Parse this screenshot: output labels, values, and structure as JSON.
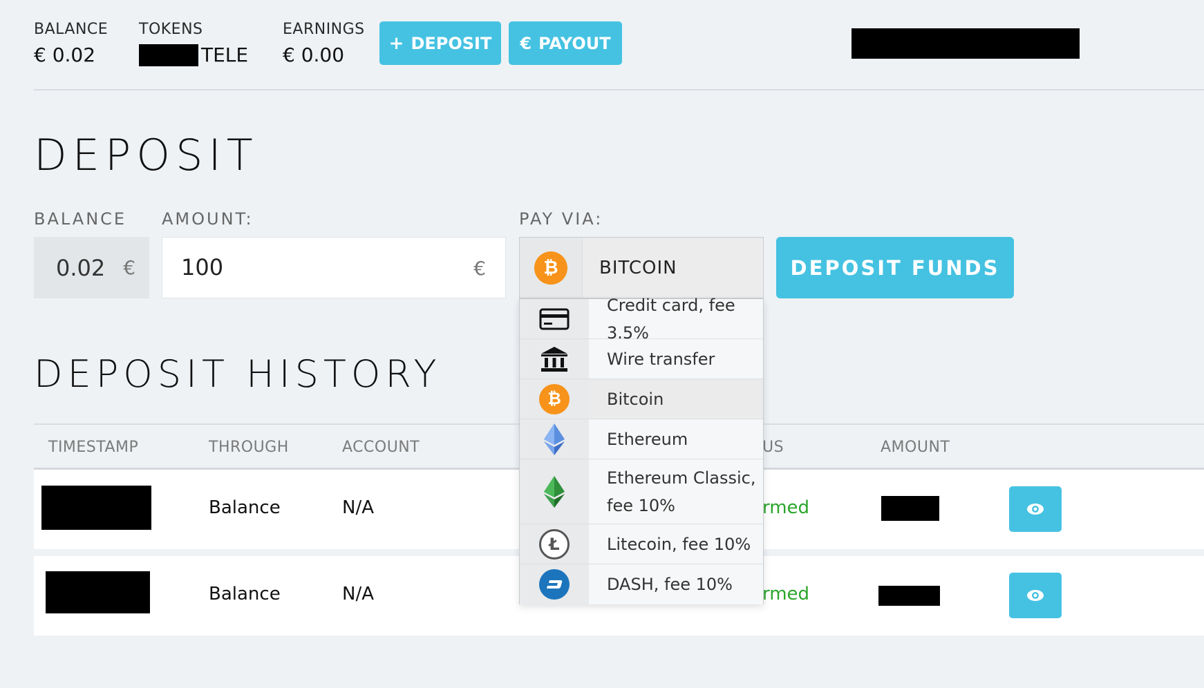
{
  "header": {
    "balance_label": "BALANCE",
    "balance_value": "€ 0.02",
    "tokens_label": "TOKENS",
    "tokens_suffix": "TELE",
    "earnings_label": "EARNINGS",
    "earnings_value": "€ 0.00",
    "deposit_btn": "DEPOSIT",
    "payout_btn": "PAYOUT",
    "deposit_icon": "+",
    "payout_icon": "€"
  },
  "deposit": {
    "title": "DEPOSIT",
    "balance_label": "BALANCE",
    "balance_value": "0.02",
    "currency": "€",
    "amount_label": "AMOUNT:",
    "amount_value": "100",
    "pay_via_label": "PAY VIA:",
    "selected_method": "BITCOIN",
    "submit_label": "DEPOSIT FUNDS"
  },
  "payment_options": [
    {
      "label": "Credit card, fee 3.5%",
      "icon": "credit-card-icon"
    },
    {
      "label": "Wire transfer",
      "icon": "bank-icon"
    },
    {
      "label": "Bitcoin",
      "icon": "bitcoin-icon"
    },
    {
      "label": "Ethereum",
      "icon": "ethereum-icon"
    },
    {
      "label": "Ethereum Classic,",
      "label2": "fee 10%",
      "icon": "ethereum-classic-icon"
    },
    {
      "label": "Litecoin, fee 10%",
      "icon": "litecoin-icon"
    },
    {
      "label": "DASH, fee 10%",
      "icon": "dash-icon"
    }
  ],
  "history": {
    "title": "DEPOSIT HISTORY",
    "columns": [
      "TIMESTAMP",
      "THROUGH",
      "ACCOUNT",
      "US",
      "AMOUNT"
    ],
    "rows": [
      {
        "through": "Balance",
        "account": "N/A",
        "status": "rmed"
      },
      {
        "through": "Balance",
        "account": "N/A",
        "status": "rmed"
      }
    ]
  },
  "colors": {
    "accent": "#45c2e2",
    "bitcoin": "#f7931a",
    "status_ok": "#2aa52a",
    "dash": "#1c75bc"
  }
}
